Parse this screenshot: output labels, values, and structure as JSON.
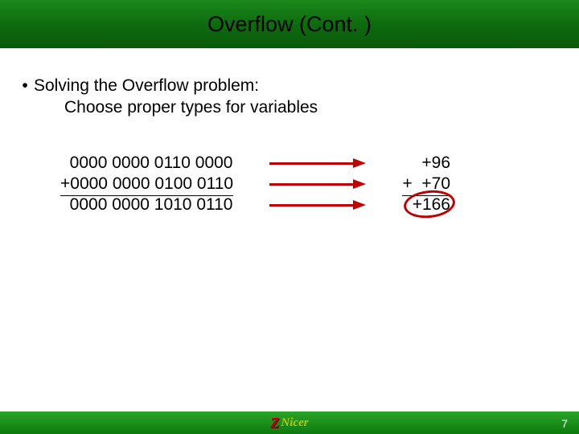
{
  "title": "Overflow (Cont. )",
  "bullets": {
    "main": "Solving the Overflow problem:",
    "sub": "Choose proper types for variables"
  },
  "calc": {
    "left": {
      "row1": "  0000 0000 0110 0000",
      "row2": "+0000 0000 0100 0110",
      "row3": "  0000 0000 1010 0110"
    },
    "right": {
      "row1": "+96",
      "row2": "+  +70",
      "row3": "+166"
    }
  },
  "footer": {
    "logo_z": "Z",
    "logo_text": "Nicer",
    "page_num": "7"
  },
  "colors": {
    "accent_red": "#c00000",
    "title_green": "#0e6b0e",
    "footer_green": "#0e7a0e"
  }
}
